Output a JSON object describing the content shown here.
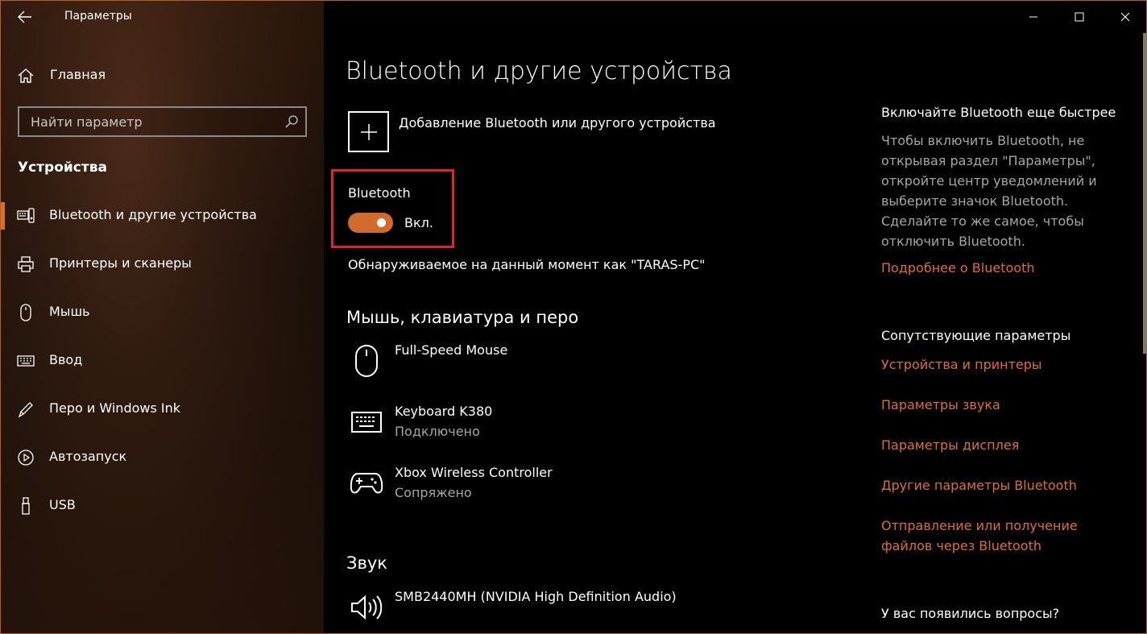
{
  "window": {
    "app_title": "Параметры",
    "controls": [
      "minimize",
      "maximize",
      "close"
    ]
  },
  "sidebar": {
    "home_label": "Главная",
    "search_placeholder": "Найти параметр",
    "section_title": "Устройства",
    "items": [
      {
        "label": "Bluetooth и другие устройства",
        "icon": "bluetooth-devices-icon",
        "active": true
      },
      {
        "label": "Принтеры и сканеры",
        "icon": "printer-icon",
        "active": false
      },
      {
        "label": "Мышь",
        "icon": "mouse-icon",
        "active": false
      },
      {
        "label": "Ввод",
        "icon": "keyboard-icon",
        "active": false
      },
      {
        "label": "Перо и Windows Ink",
        "icon": "pen-icon",
        "active": false
      },
      {
        "label": "Автозапуск",
        "icon": "autoplay-icon",
        "active": false
      },
      {
        "label": "USB",
        "icon": "usb-icon",
        "active": false
      }
    ]
  },
  "main": {
    "title": "Bluetooth и другие устройства",
    "add_device_label": "Добавление Bluetooth или другого устройства",
    "bluetooth": {
      "label": "Bluetooth",
      "toggle_state": "Вкл.",
      "on": true
    },
    "discoverable": "Обнаруживаемое на данный момент как \"TARAS-PC\"",
    "sections": {
      "input": {
        "title": "Мышь, клавиатура и перо",
        "devices": [
          {
            "name": "Full-Speed Mouse",
            "status": "",
            "icon": "mouse-icon"
          },
          {
            "name": "Keyboard K380",
            "status": "Подключено",
            "icon": "keyboard-icon"
          },
          {
            "name": "Xbox Wireless Controller",
            "status": "Сопряжено",
            "icon": "gamepad-icon"
          }
        ]
      },
      "audio": {
        "title": "Звук",
        "devices": [
          {
            "name": "SMB2440MH (NVIDIA High Definition Audio)",
            "status": "",
            "icon": "speaker-icon"
          }
        ]
      }
    }
  },
  "right_panel": {
    "quick_title": "Включайте Bluetooth еще быстрее",
    "quick_text": "Чтобы включить Bluetooth, не открывая раздел \"Параметры\", откройте центр уведомлений и выберите значок Bluetooth. Сделайте то же самое, чтобы отключить Bluetooth.",
    "more_link": "Подробнее о Bluetooth",
    "related_title": "Сопутствующие параметры",
    "related_links": [
      "Устройства и принтеры",
      "Параметры звука",
      "Параметры дисплея",
      "Другие параметры Bluetooth",
      "Отправление или получение файлов через Bluetooth"
    ],
    "questions_title": "У вас появились вопросы?"
  },
  "colors": {
    "accent": "#dd6f32",
    "toggle_on": "#d06a2d",
    "highlight_box": "#e0242b",
    "secondary_text": "#a6a6a6"
  }
}
